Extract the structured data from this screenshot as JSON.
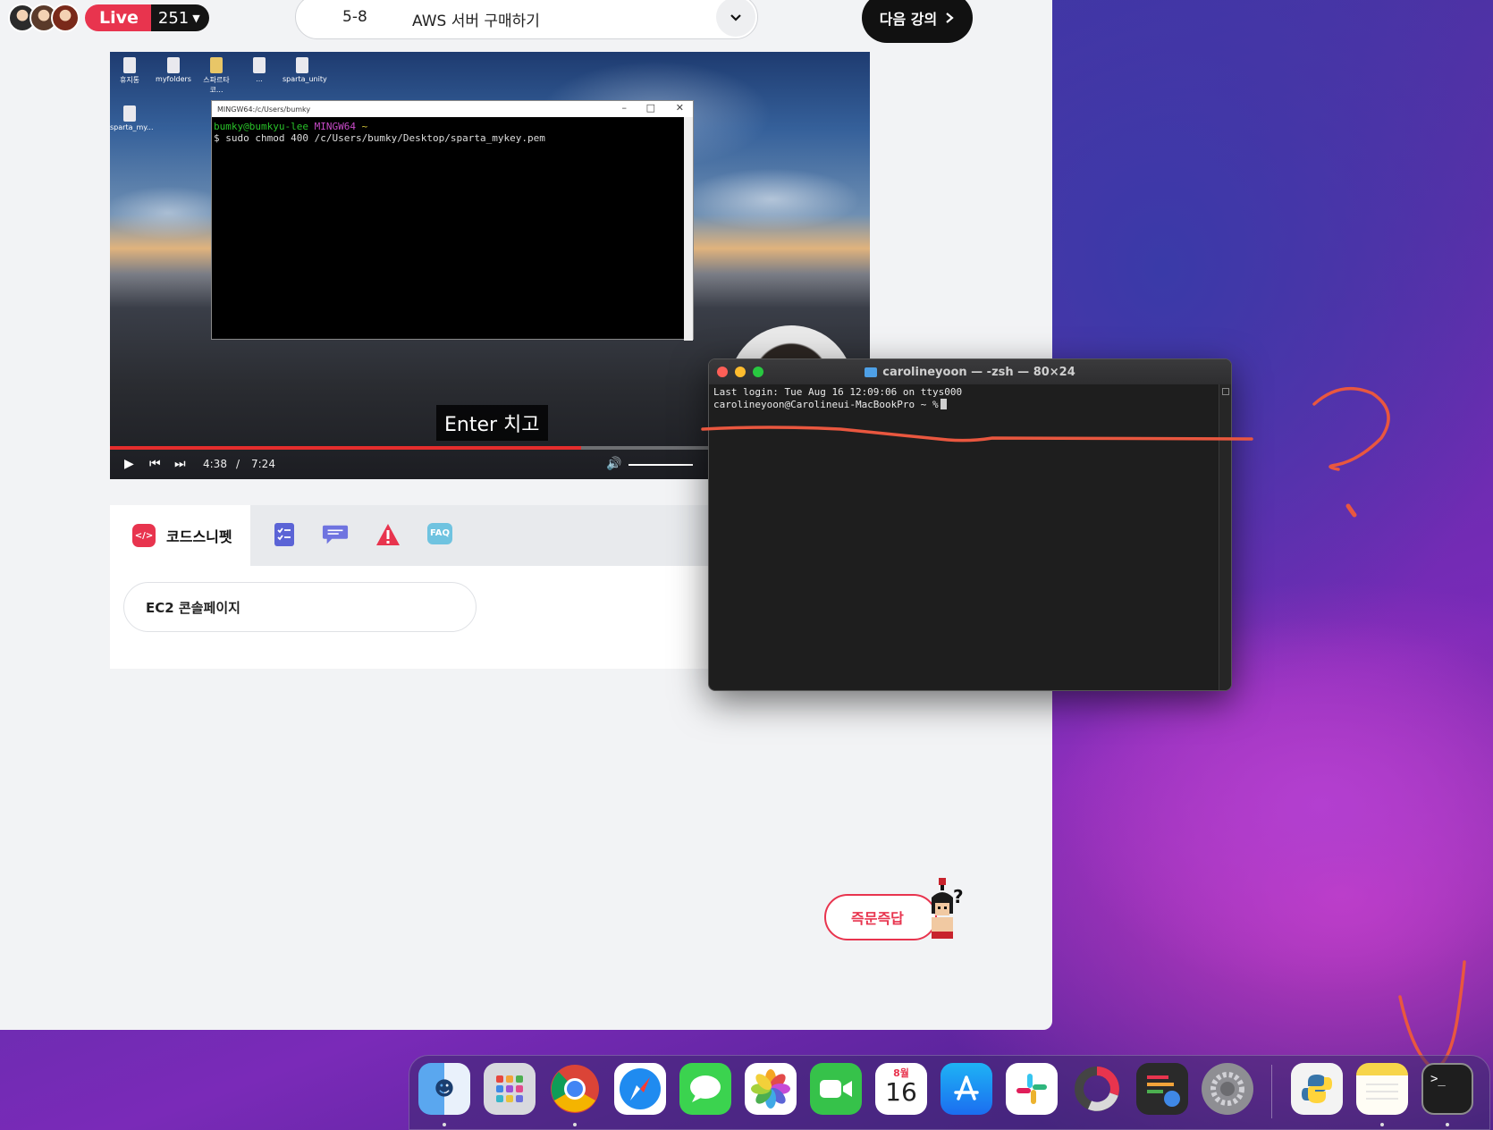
{
  "header": {
    "live_label": "Live",
    "viewer_count": "251",
    "lecture_number": "5-8",
    "lecture_title": "AWS 서버 구매하기",
    "next_button_label": "다음 강의"
  },
  "video": {
    "desktop_icons": [
      "휴지통",
      "myfolders",
      "스파르타코...",
      "...",
      "sparta_unity",
      "sparta_my..."
    ],
    "mingw_title": "MINGW64:/c/Users/bumky",
    "mingw_prompt_user": "bumky@bumkyu-lee",
    "mingw_prompt_env": "MINGW64",
    "mingw_prompt_dir": "~",
    "mingw_command": "$ sudo chmod 400 /c/Users/bumky/Desktop/sparta_mykey.pem",
    "subtitle": "Enter 치고",
    "current_time": "4:38",
    "time_separator": "/",
    "duration": "7:24",
    "progress_fraction": 0.62
  },
  "tabs": {
    "active_label": "코드스니펫",
    "icons": [
      "code-snippet-icon",
      "checklist-icon",
      "chat-icon",
      "warning-icon",
      "faq-icon"
    ],
    "faq_label": "FAQ",
    "snippet_button": "EC2 콘솔페이지"
  },
  "qna_button": "즉문즉답",
  "terminal": {
    "title": "carolineyoon — -zsh — 80×24",
    "line1": "Last login: Tue Aug 16 12:09:06 on ttys000",
    "line2": "carolineyoon@Carolineui-MacBookPro ~ %"
  },
  "dock": {
    "apps": [
      "finder-icon",
      "launchpad-icon",
      "chrome-icon",
      "safari-icon",
      "messages-icon",
      "photos-icon",
      "facetime-icon",
      "calendar-icon",
      "app-store-icon",
      "slack-icon",
      "istat-icon",
      "color-ui-icon",
      "system-settings-icon",
      "python-launcher-icon",
      "notes-icon",
      "terminal-icon"
    ],
    "calendar_month": "8월",
    "calendar_day": "16"
  },
  "colors": {
    "accent_red": "#e8344e",
    "annotation_red": "#e9573f"
  }
}
